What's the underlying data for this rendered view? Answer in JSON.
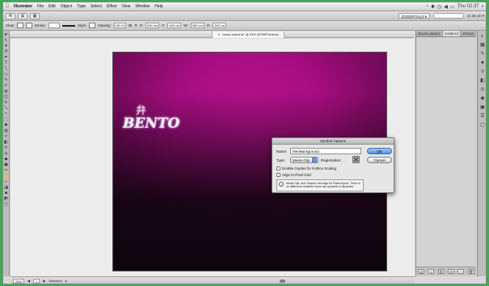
{
  "menubar": {
    "apple": "",
    "items": [
      "Illustrator",
      "File",
      "Edit",
      "Object",
      "Type",
      "Select",
      "Effect",
      "View",
      "Window",
      "Help"
    ],
    "clock": "Thu 02:37"
  },
  "appbar": {
    "workspace": "ESSENTIALS ▾",
    "zoom": "◎ 25 cm ▾"
  },
  "controlbar": {
    "mode_label": "Clear",
    "stroke_label": "Stroke:",
    "style_label": "Style:",
    "opacity_label": "Opacity:",
    "opacity_value": "100 %",
    "x_label": "X:",
    "x_value": "200 cm",
    "y_label": "Y:",
    "y_value": "150 cm",
    "w_label": "W:",
    "w_value": "300 cm",
    "h_label": "H:",
    "h_value": "300 cm"
  },
  "document": {
    "tab_title": "bento brand.ai* @ 25% (RGB/Preview)"
  },
  "artwork": {
    "kanji": "弁",
    "word": "BENTO"
  },
  "dialog": {
    "title": "Symbol Options",
    "name_label": "Name:",
    "name_value": "MenBackground",
    "type_label": "Type:",
    "type_value": "Movie Clip",
    "registration_label": "Registration:",
    "ok_label": "OK",
    "cancel_label": "Cancel",
    "check_9slice": "Enable Guides for 9-Slice Scaling",
    "check_pixel": "Align to Pixel Grid",
    "note": "Movie Clip' and 'Graphic' are tags for Flash import. There is no difference between these two symbols in Illustrator.",
    "registration_selected": 4
  },
  "status": {
    "zoom": "25%",
    "page": "1",
    "tool": "Selection"
  },
  "panels": {
    "tabs": [
      "BRUSH LIBRARY",
      "SYMBOLS",
      "STROKE"
    ],
    "active_tab": 1
  },
  "colors": {
    "artboard_magenta": "#a70d80",
    "ok_button": "#4f8ee6",
    "desktop": "#3fa85a"
  }
}
